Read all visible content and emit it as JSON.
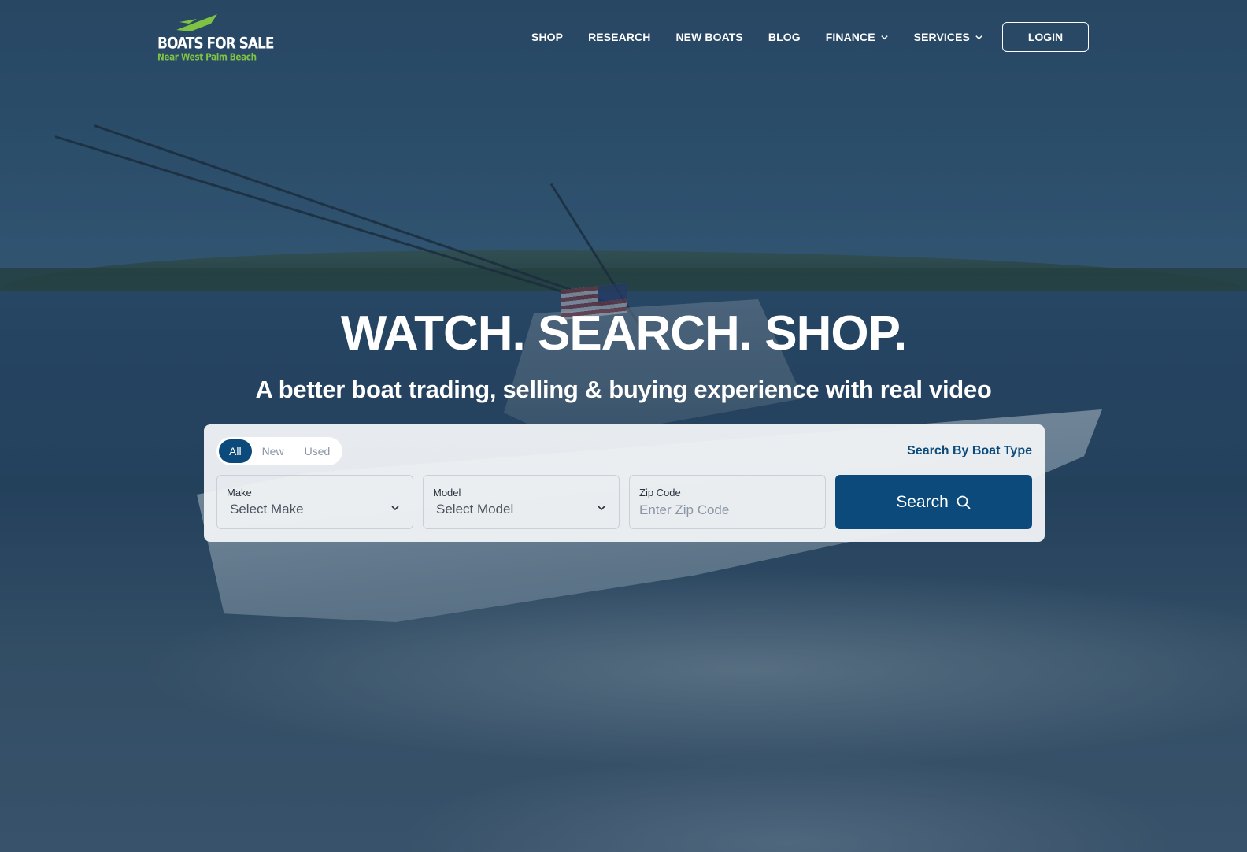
{
  "logo": {
    "title": "BOATS FOR SALE",
    "subtitle": "Near West Palm Beach"
  },
  "nav": {
    "items": [
      {
        "label": "SHOP",
        "dropdown": false
      },
      {
        "label": "RESEARCH",
        "dropdown": false
      },
      {
        "label": "NEW BOATS",
        "dropdown": false
      },
      {
        "label": "BLOG",
        "dropdown": false
      },
      {
        "label": "FINANCE",
        "dropdown": true
      },
      {
        "label": "SERVICES",
        "dropdown": true
      }
    ],
    "login_label": "LOGIN"
  },
  "hero": {
    "title": "WATCH. SEARCH. SHOP.",
    "subtitle": "A better boat trading, selling & buying experience with real video"
  },
  "search": {
    "toggles": [
      {
        "label": "All",
        "active": true
      },
      {
        "label": "New",
        "active": false
      },
      {
        "label": "Used",
        "active": false
      }
    ],
    "type_link": "Search By Boat Type",
    "make": {
      "label": "Make",
      "value": "Select Make"
    },
    "model": {
      "label": "Model",
      "value": "Select Model"
    },
    "zip": {
      "label": "Zip Code",
      "placeholder": "Enter Zip Code"
    },
    "button_label": "Search"
  },
  "colors": {
    "brand_blue": "#0b4a7a",
    "logo_green": "#7dc243",
    "text_white": "#ffffff"
  },
  "icons": [
    "logo-boat-icon",
    "chevron-down-icon",
    "search-icon"
  ]
}
